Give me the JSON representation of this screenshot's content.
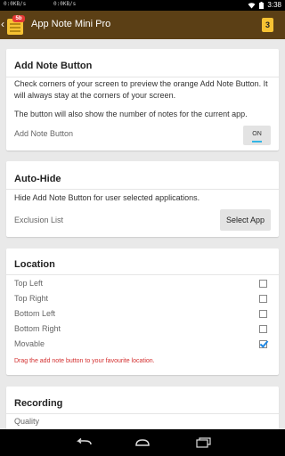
{
  "status_bar": {
    "net_left": "0:0KB/s",
    "net_right": "0:0KB/s",
    "time": "3:38"
  },
  "action_bar": {
    "title": "App Note Mini Pro",
    "icon_badge": "5b",
    "note_count": "3"
  },
  "add_note_card": {
    "title": "Add Note Button",
    "description_1": "Check corners of your screen to preview the orange Add Note Button. It will always stay at the corners of your screen.",
    "description_2": "The button will also show the number of notes for the current app.",
    "setting_label": "Add Note Button",
    "toggle_label": "ON",
    "toggle_on": true
  },
  "auto_hide_card": {
    "title": "Auto-Hide",
    "description": "Hide Add Note Button for user selected applications.",
    "exclusion_label": "Exclusion List",
    "select_app_label": "Select App"
  },
  "location_card": {
    "title": "Location",
    "options": [
      {
        "label": "Top Left",
        "checked": false
      },
      {
        "label": "Top Right",
        "checked": false
      },
      {
        "label": "Bottom Left",
        "checked": false
      },
      {
        "label": "Bottom Right",
        "checked": false
      },
      {
        "label": "Movable",
        "checked": true
      }
    ],
    "hint": "Drag the add note button to your favourite location.",
    "hint_color": "#d32f2f"
  },
  "recording_card": {
    "title": "Recording",
    "quality_label": "Quality"
  },
  "nav_bar": {
    "back_icon": "back-arrow-icon",
    "home_icon": "home-icon",
    "recents_icon": "recents-icon"
  },
  "colors": {
    "action_bar": "#5b3f15",
    "accent": "#33b5e5",
    "note_yellow": "#f6c233",
    "check_blue": "#1e88e5"
  }
}
